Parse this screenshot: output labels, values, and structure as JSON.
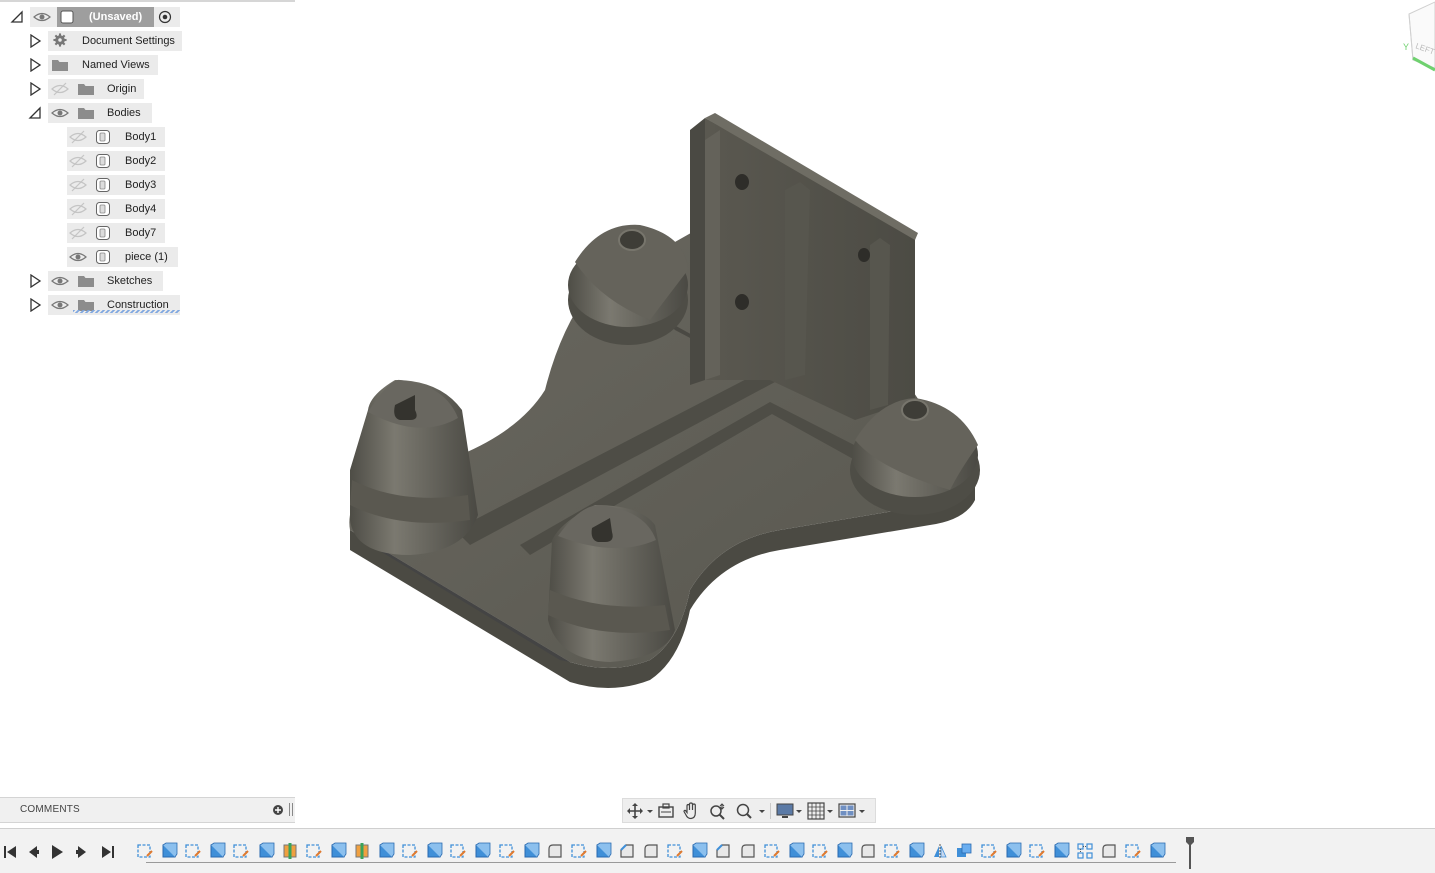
{
  "browser": {
    "root": {
      "label": "(Unsaved)"
    },
    "items": [
      {
        "label": "Document Settings",
        "icon": "gear-icon",
        "expanded": false,
        "visible": null
      },
      {
        "label": "Named Views",
        "icon": "folder-icon",
        "expanded": false,
        "visible": null
      },
      {
        "label": "Origin",
        "icon": "folder-icon",
        "expanded": false,
        "visible": false
      },
      {
        "label": "Bodies",
        "icon": "folder-icon",
        "expanded": true,
        "visible": true
      },
      {
        "label": "Sketches",
        "icon": "folder-icon",
        "expanded": false,
        "visible": true
      },
      {
        "label": "Construction",
        "icon": "folder-icon",
        "expanded": false,
        "visible": true
      }
    ],
    "bodies": [
      {
        "label": "Body1",
        "visible": false
      },
      {
        "label": "Body2",
        "visible": false
      },
      {
        "label": "Body3",
        "visible": false
      },
      {
        "label": "Body4",
        "visible": false
      },
      {
        "label": "Body7",
        "visible": false
      },
      {
        "label": "piece (1)",
        "visible": true
      }
    ]
  },
  "comments": {
    "title": "COMMENTS"
  },
  "navbar": {
    "buttons": [
      "orbit-icon",
      "look-at-icon",
      "pan-icon",
      "zoom-icon",
      "fit-icon",
      "display-settings-icon",
      "grid-icon",
      "viewports-icon"
    ]
  },
  "viewcube": {
    "face_label": "LEFT",
    "axis_label": "Y"
  },
  "timeline": {
    "controls": [
      "skip-to-start-icon",
      "step-back-icon",
      "play-icon",
      "step-forward-icon",
      "skip-to-end-icon"
    ],
    "features": [
      "sketch",
      "extrude",
      "sketch",
      "extrude",
      "sketch",
      "extrude",
      "split",
      "sketch",
      "extrude",
      "split",
      "extrude",
      "sketch",
      "extrude",
      "sketch",
      "extrude",
      "sketch",
      "extrude",
      "fillet",
      "sketch",
      "extrude",
      "chamfer",
      "fillet",
      "sketch",
      "extrude",
      "chamfer",
      "fillet",
      "sketch",
      "extrude",
      "sketch",
      "extrude",
      "fillet",
      "sketch",
      "extrude",
      "mirror",
      "combine",
      "sketch",
      "extrude",
      "sketch",
      "extrude",
      "pattern",
      "fillet",
      "sketch",
      "extrude"
    ]
  },
  "colors": {
    "model_main": "#5c5a52",
    "model_light": "#6e6c63",
    "model_dark": "#47463f",
    "panel_bg": "#ebebeb",
    "root_bg": "#9e9e9e",
    "sketch_feature": "#e07a2f",
    "extrude_feature": "#3f8fd8",
    "viewcube_green": "#6fd16f"
  }
}
